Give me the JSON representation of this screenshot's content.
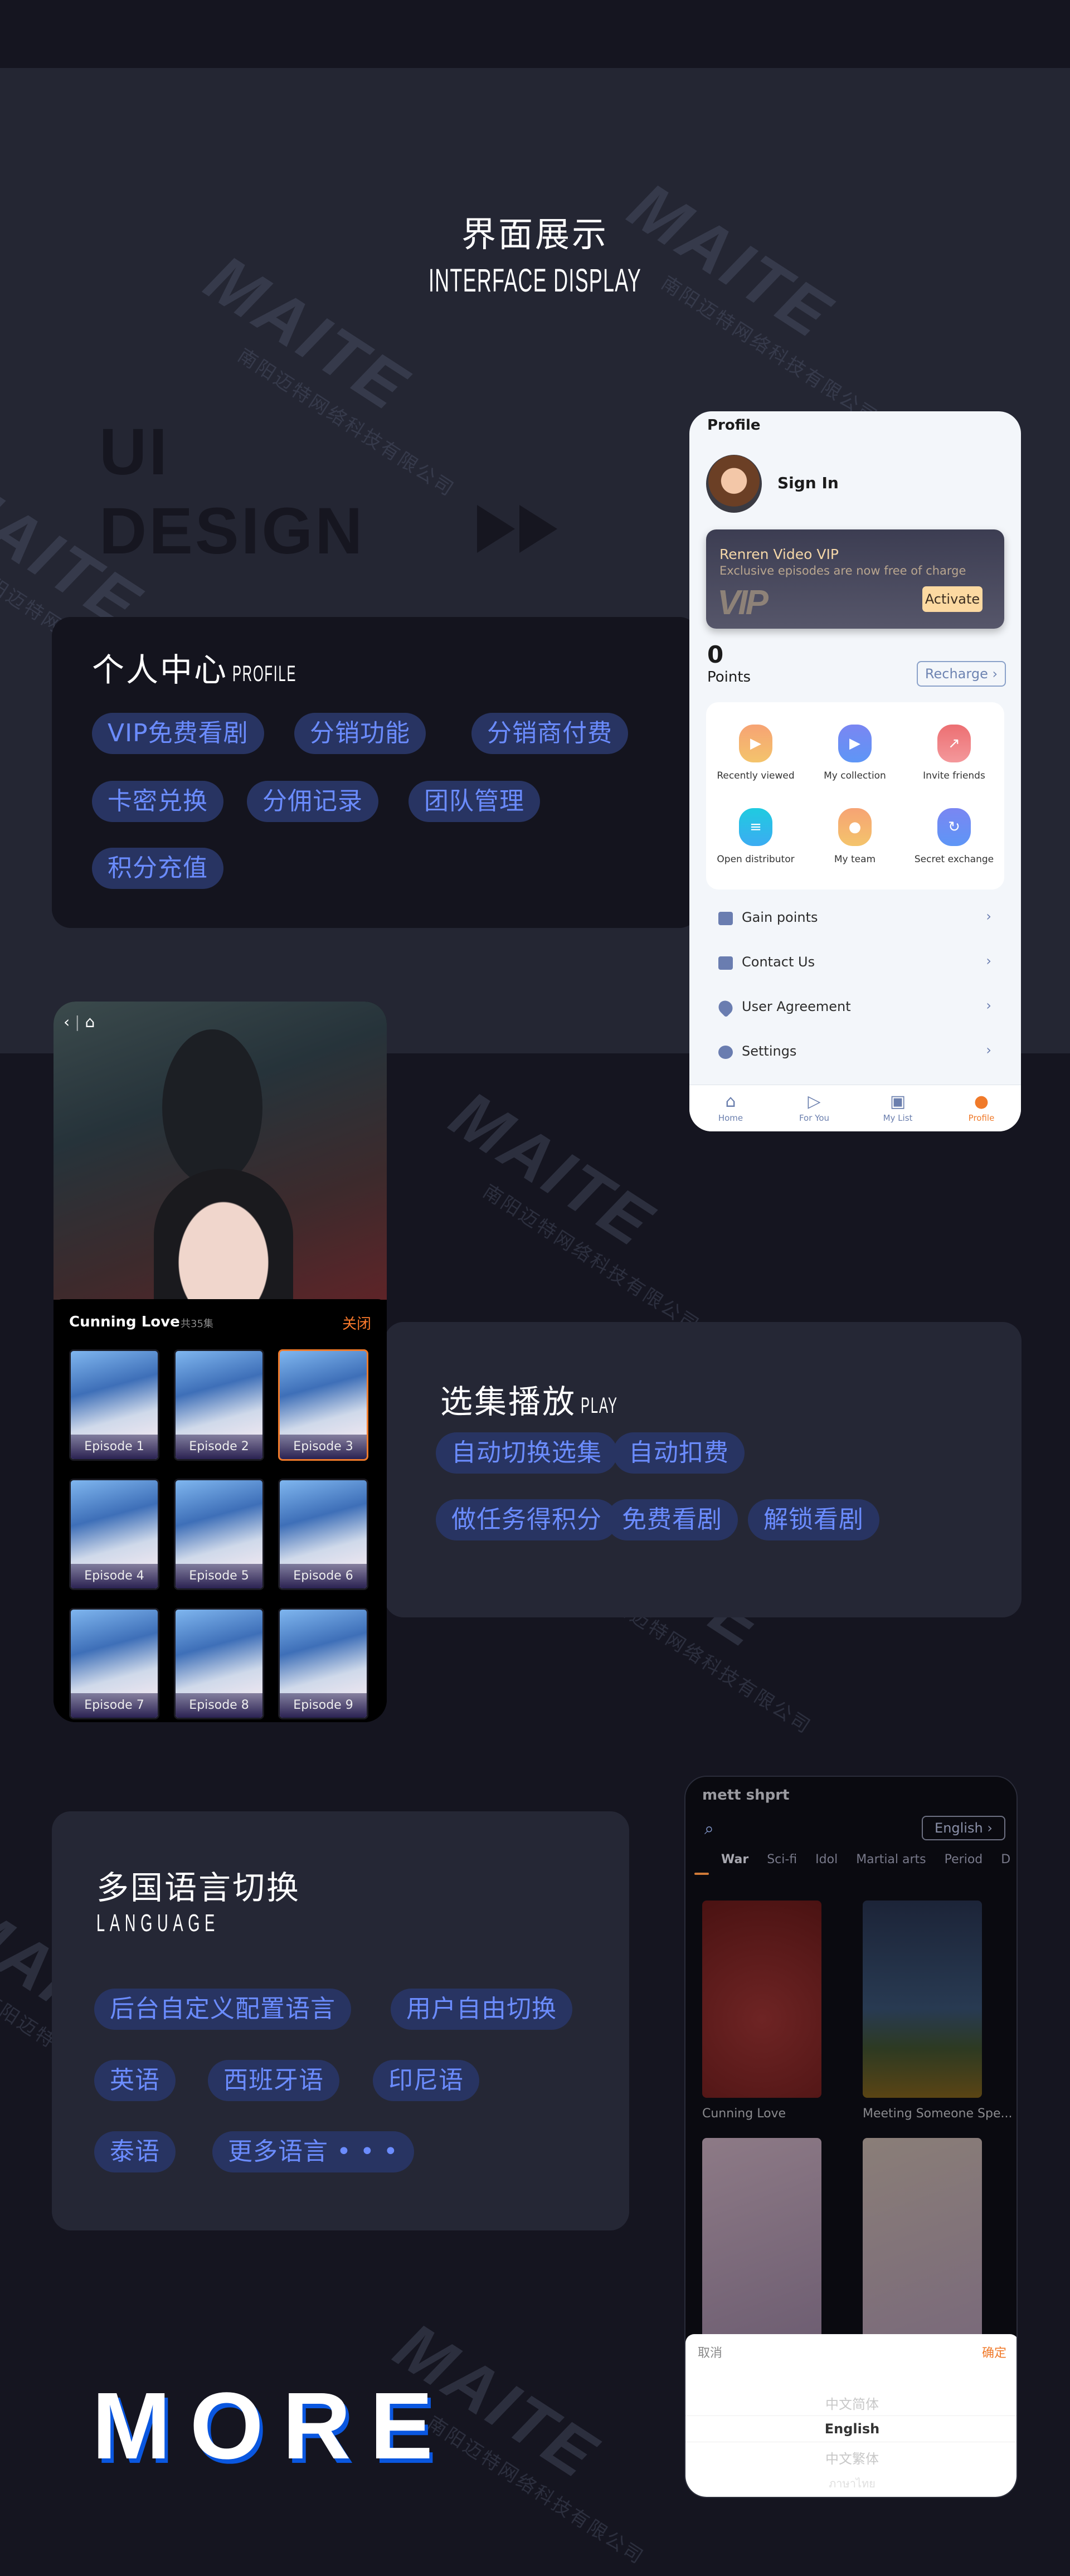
{
  "hero": {
    "title_cn": "界面展示",
    "title_en": "INTERFACE DISPLAY"
  },
  "ui_design": {
    "line1": "UI",
    "line2": "DESIGN"
  },
  "watermark": {
    "logo": "MAITE",
    "company": "南阳迈特网络科技有限公司"
  },
  "profile_section": {
    "title": "个人中心",
    "subtitle": "PROFILE",
    "tags": [
      "VIP免费看剧",
      "分销功能",
      "分销商付费",
      "卡密兑换",
      "分佣记录",
      "团队管理",
      "积分充值"
    ]
  },
  "profile_phone": {
    "header": "Profile",
    "sign_in": "Sign In",
    "vip": {
      "title": "Renren Video VIP",
      "subtitle": "Exclusive episodes are now free of charge",
      "logo": "VIP",
      "activate": "Activate"
    },
    "points_value": "0",
    "points_label": "Points",
    "recharge": "Recharge",
    "grid": [
      {
        "label": "Recently viewed",
        "icon": "film-icon",
        "color": "#f4a96b"
      },
      {
        "label": "My collection",
        "icon": "calendar-play-icon",
        "color": "#6b8cf5"
      },
      {
        "label": "Invite friends",
        "icon": "arrow-up-right-icon",
        "color": "#ef7b7e"
      },
      {
        "label": "Open distributor",
        "icon": "bookmark-icon",
        "color": "#2ec3e6"
      },
      {
        "label": "My team",
        "icon": "person-icon",
        "color": "#f4ae6e"
      },
      {
        "label": "Secret exchange",
        "icon": "refresh-icon",
        "color": "#6b8cf5"
      }
    ],
    "menu": [
      {
        "label": "Gain points",
        "icon": "chat-icon"
      },
      {
        "label": "Contact Us",
        "icon": "contact-icon"
      },
      {
        "label": "User Agreement",
        "icon": "heart-icon"
      },
      {
        "label": "Settings",
        "icon": "settings-icon"
      }
    ],
    "nav": [
      {
        "label": "Home",
        "active": false
      },
      {
        "label": "For You",
        "active": false
      },
      {
        "label": "My List",
        "active": false
      },
      {
        "label": "Profile",
        "active": true
      }
    ],
    "active_color": "#f07a2a"
  },
  "play_phone": {
    "series_title": "Cunning Love",
    "episode_count": "共35集",
    "close": "关闭",
    "episodes": [
      "Episode 1",
      "Episode 2",
      "Episode 3",
      "Episode 4",
      "Episode 5",
      "Episode 6",
      "Episode 7",
      "Episode 8",
      "Episode 9"
    ],
    "selected_episode": "Episode 3"
  },
  "play_section": {
    "title": "选集播放",
    "subtitle": "PLAY",
    "tags": [
      "自动切换选集",
      "自动扣费",
      "做任务得积分",
      "免费看剧",
      "解锁看剧"
    ]
  },
  "language_section": {
    "title": "多国语言切换",
    "subtitle": "LANGUAGE",
    "tags": [
      "后台自定义配置语言",
      "用户自由切换",
      "英语",
      "西班牙语",
      "印尼语",
      "泰语",
      "更多语言 • • •"
    ]
  },
  "language_phone": {
    "app_title": "mett shprt",
    "language_button": "English",
    "categories": [
      "War",
      "Sci-fi",
      "Idol",
      "Martial arts",
      "Period",
      "D"
    ],
    "active_category": "War",
    "covers": [
      {
        "title": "Cunning Love"
      },
      {
        "title": "Meeting Someone Spe..."
      },
      {
        "title": ""
      },
      {
        "title": ""
      }
    ],
    "picker": {
      "cancel": "取消",
      "confirm": "确定",
      "options": [
        "中文简体",
        "English",
        "中文繁体",
        "ภาษาไทย"
      ],
      "selected": "English"
    }
  },
  "more": {
    "label": "MORE"
  }
}
